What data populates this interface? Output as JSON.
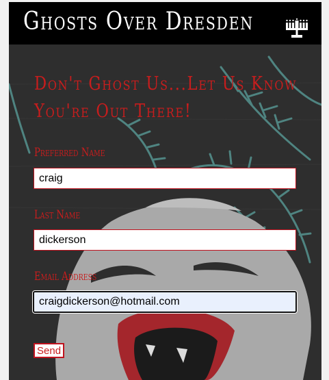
{
  "header": {
    "site_title": "Ghosts Over Dresden",
    "menu_icon": "menorah-icon"
  },
  "form": {
    "heading_line1": "Don't Ghost Us...Let Us Know",
    "heading_line2": "You're Out There!",
    "fields": [
      {
        "label": "Preferred Name",
        "value": "craig"
      },
      {
        "label": "Last Name",
        "value": "dickerson"
      },
      {
        "label": "Email Address",
        "value": "craigdickerson@hotmail.com"
      }
    ],
    "send_label": "Send"
  },
  "colors": {
    "accent": "#c71d1d",
    "header_bg": "#000000",
    "background": "#2e2e2e"
  }
}
